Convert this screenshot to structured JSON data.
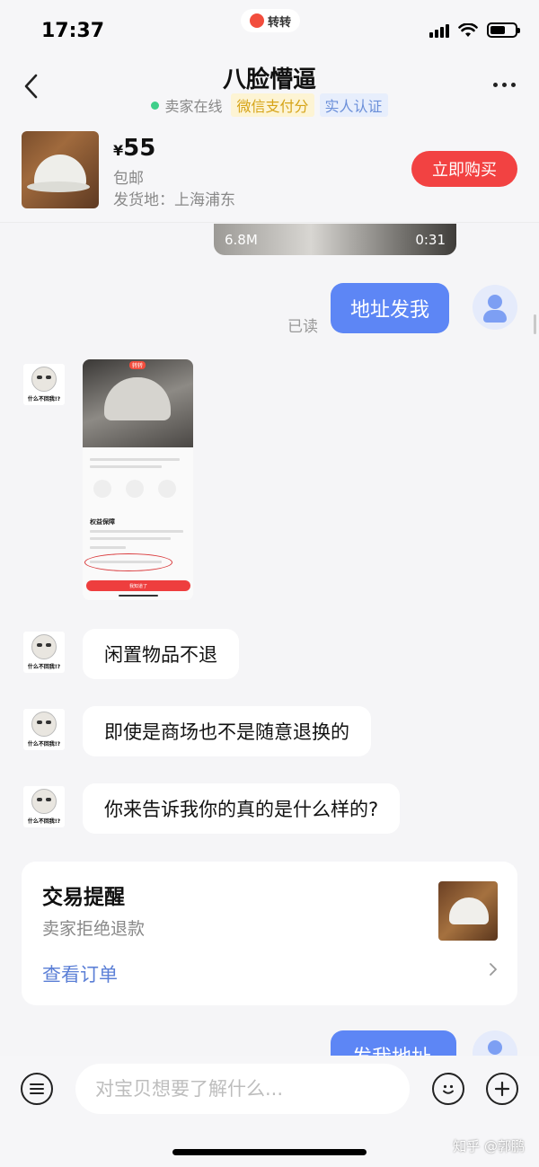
{
  "status_bar": {
    "time": "17:37",
    "app_name": "转转",
    "battery_level": 0.6
  },
  "header": {
    "title": "八脸懵逼",
    "online_status": "卖家在线",
    "badge_wechat_pay": "微信支付分",
    "badge_verified": "实人认证"
  },
  "product": {
    "price_symbol": "¥",
    "price": "55",
    "shipping": "包邮",
    "origin": "发货地：上海浦东",
    "buy_label": "立即购买"
  },
  "messages": {
    "video": {
      "size": "6.8M",
      "duration": "0:31"
    },
    "read_label": "已读",
    "outgoing_1": "地址发我",
    "peer_avatar_caption": "什么不回我!?",
    "screenshot_title": "权益保障",
    "screenshot_button": "我知道了",
    "screenshot_logo": "转转",
    "incoming_1": "闲置物品不退",
    "incoming_2": "即使是商场也不是随意退换的",
    "incoming_3": "你来告诉我你的真的是什么样的?",
    "outgoing_2": "发我地址"
  },
  "trade_card": {
    "title": "交易提醒",
    "status": "卖家拒绝退款",
    "link": "查看订单"
  },
  "input_bar": {
    "placeholder": "对宝贝想要了解什么..."
  },
  "watermark": "知乎 @郭鹏",
  "colors": {
    "accent_blue": "#5d86f5",
    "buy_red": "#f24242",
    "online_green": "#3fcf8a",
    "wechat_badge": "#d6a418",
    "verify_badge": "#6b8fd9",
    "link_blue": "#5b7fd6"
  }
}
